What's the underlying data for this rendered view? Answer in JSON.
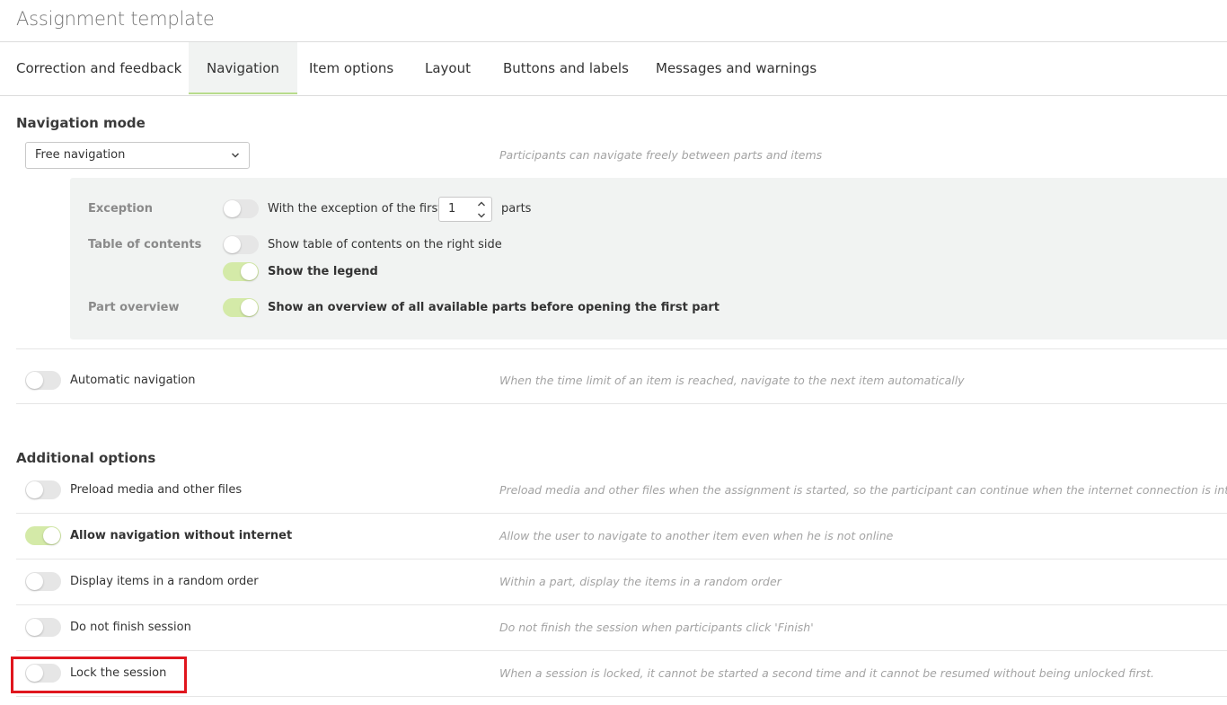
{
  "page": {
    "title": "Assignment template"
  },
  "tabs": [
    {
      "label": "Correction and feedback"
    },
    {
      "label": "Navigation",
      "active": true
    },
    {
      "label": "Item options"
    },
    {
      "label": "Layout"
    },
    {
      "label": "Buttons and labels"
    },
    {
      "label": "Messages and warnings"
    }
  ],
  "navigation_mode": {
    "heading": "Navigation mode",
    "select_value": "Free navigation",
    "hint": "Participants can navigate freely between parts and items",
    "panel": {
      "exception_label": "Exception",
      "exception_toggle_on": false,
      "exception_text": "With the exception of the first",
      "exception_count": "1",
      "exception_suffix": "parts",
      "toc_label": "Table of contents",
      "toc_toggle_on": false,
      "toc_text": "Show table of contents on the right side",
      "legend_toggle_on": true,
      "legend_text": "Show the legend",
      "part_overview_label": "Part overview",
      "part_overview_toggle_on": true,
      "part_overview_text": "Show an overview of all available parts before opening the first part"
    },
    "automatic": {
      "label": "Automatic navigation",
      "on": false,
      "hint": "When the time limit of an item is reached, navigate to the next item automatically"
    }
  },
  "additional_options": {
    "heading": "Additional options",
    "items": [
      {
        "label": "Preload media and other files",
        "on": false,
        "hint": "Preload media and other files when the assignment is started, so the participant can continue when the internet connection is interrupted"
      },
      {
        "label": "Allow navigation without internet",
        "on": true,
        "hint": "Allow the user to navigate to another item even when he is not online"
      },
      {
        "label": "Display items in a random order",
        "on": false,
        "hint": "Within a part, display the items in a random order"
      },
      {
        "label": "Do not finish session",
        "on": false,
        "hint": "Do not finish the session when participants click 'Finish'"
      },
      {
        "label": "Lock the session",
        "on": false,
        "hint": "When a session is locked, it cannot be started a second time and it cannot be resumed without being unlocked first."
      }
    ]
  },
  "colors": {
    "toggle_on": "#d4eaa8",
    "toggle_off": "#e6e6e6",
    "highlight": "#e0161e",
    "tab_underline": "#b8dc8c"
  },
  "icons": {
    "select_chevron": "chevron-down-icon",
    "spinner": "spinner-arrows-icon"
  }
}
